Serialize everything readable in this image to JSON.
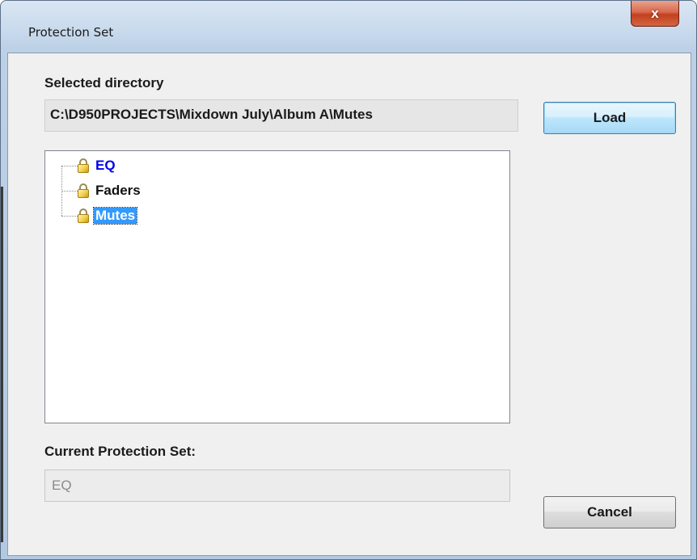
{
  "window": {
    "title": "Protection Set",
    "close_glyph": "x"
  },
  "selected_directory": {
    "label": "Selected directory",
    "path": "C:\\D950PROJECTS\\Mixdown July\\Album A\\Mutes"
  },
  "buttons": {
    "load": "Load",
    "cancel": "Cancel"
  },
  "tree": {
    "items": [
      {
        "label": "EQ",
        "icon": "lock-icon",
        "state": "highlighted"
      },
      {
        "label": "Faders",
        "icon": "lock-icon",
        "state": "normal"
      },
      {
        "label": "Mutes",
        "icon": "lock-icon",
        "state": "selected"
      }
    ]
  },
  "current_protection_set": {
    "label": "Current Protection Set:",
    "value": "EQ"
  },
  "colors": {
    "highlight_text": "#0000ee",
    "selection_bg": "#3399ff",
    "close_button": "#c3401f"
  }
}
